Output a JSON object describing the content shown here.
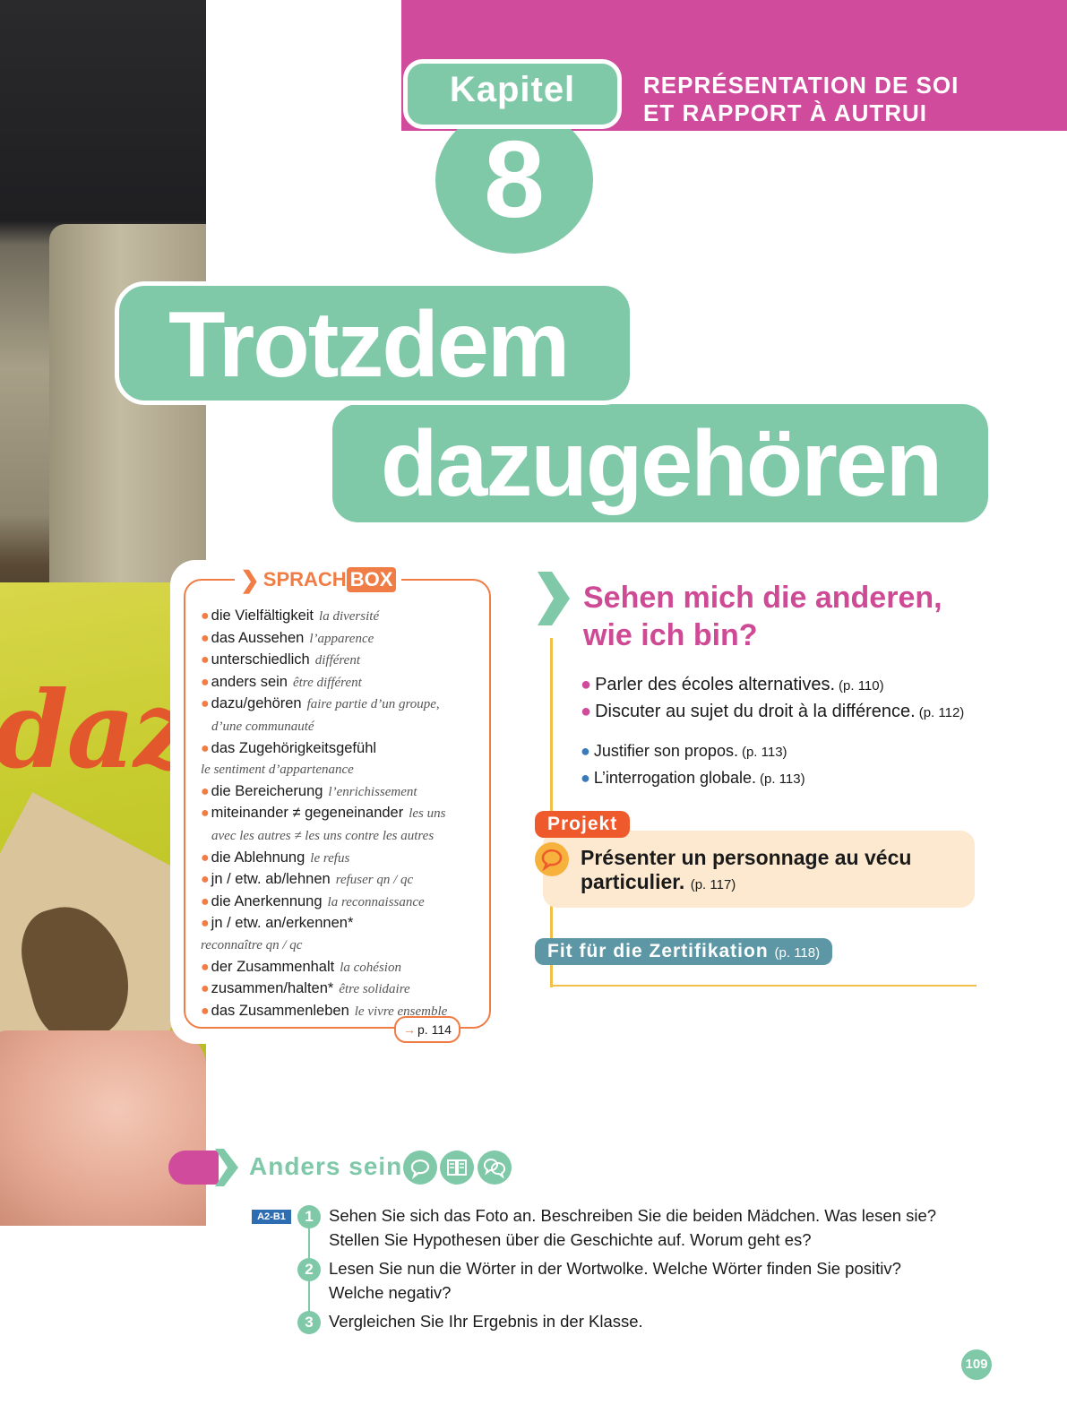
{
  "header": {
    "chapter_label": "Kapitel",
    "chapter_number": "8",
    "theme_line1": "REPRÉSENTATION DE SOI",
    "theme_line2": "ET RAPPORT À AUTRUI"
  },
  "title": {
    "line1": "Trotzdem",
    "line2": "dazugehören"
  },
  "photo": {
    "book_word": "dazu"
  },
  "sprachbox": {
    "label_part1": "SPRACH",
    "label_part2": "BOX",
    "items": [
      {
        "de": "die Vielfältigkeit",
        "fr": "la diversité"
      },
      {
        "de": "das Aussehen",
        "fr": "l’apparence"
      },
      {
        "de": "unterschiedlich",
        "fr": "différent"
      },
      {
        "de": "anders sein",
        "fr": "être différent"
      },
      {
        "de": "dazu/gehören",
        "fr": "faire partie d’un groupe,",
        "fr2": "d’une communauté"
      },
      {
        "de": "das Zugehörigkeitsgefühl",
        "fr2": "le sentiment d’appartenance"
      },
      {
        "de": "die Bereicherung",
        "fr": "l’enrichissement"
      },
      {
        "de": "miteinander ≠ gegeneinander",
        "fr": "les uns",
        "fr2": "avec les autres ≠ les uns contre les autres"
      },
      {
        "de": "die Ablehnung",
        "fr": "le refus"
      },
      {
        "de": "jn / etw. ab/lehnen",
        "fr": "refuser qn / qc"
      },
      {
        "de": "die Anerkennung",
        "fr": "la reconnaissance"
      },
      {
        "de": "jn / etw. an/erkennen*",
        "fr2": "reconnaître qn / qc"
      },
      {
        "de": "der Zusammenhalt",
        "fr": "la cohésion"
      },
      {
        "de": "zusammen/halten*",
        "fr": "être solidaire"
      },
      {
        "de": "das Zusammenleben",
        "fr": "le vivre ensemble"
      }
    ],
    "ref": "p. 114"
  },
  "question": {
    "title_line1": "Sehen mich die anderen,",
    "title_line2": "wie ich bin?",
    "goals": [
      {
        "text": "Parler des écoles alternatives.",
        "page": "(p. 110)"
      },
      {
        "text": "Discuter au sujet du droit à la différence.",
        "page": "(p. 112)"
      }
    ],
    "grammar": [
      {
        "text": "Justifier son propos.",
        "page": "(p. 113)"
      },
      {
        "text": "L’interrogation globale.",
        "page": "(p. 113)"
      }
    ]
  },
  "projekt": {
    "tag": "Projekt",
    "line1": "Présenter un personnage au vécu",
    "line2": "particulier.",
    "page": "(p. 117)"
  },
  "fit": {
    "label": "Fit für die Zertifikation",
    "page": "(p. 118)"
  },
  "section": {
    "title": "Anders sein",
    "level": "A2-B1",
    "icons": [
      "speech-bubble-icon",
      "book-icon",
      "dialogue-icon"
    ],
    "exercises": [
      {
        "num": "1",
        "line1": "Sehen Sie sich das Foto an. Beschreiben Sie die beiden Mädchen. Was lesen sie?",
        "line2": "Stellen Sie Hypothesen über die Geschichte auf. Worum geht es?"
      },
      {
        "num": "2",
        "line1": "Lesen Sie nun die Wörter in der Wortwolke. Welche Wörter finden Sie positiv?",
        "line2": "Welche negativ?"
      },
      {
        "num": "3",
        "line1": "Vergleichen Sie Ihr Ergebnis in der Klasse.",
        "line2": ""
      }
    ]
  },
  "page_number": "109",
  "colors": {
    "magenta": "#d14b9c",
    "mint": "#7fc8a8",
    "orange": "#ef7d45",
    "projekt_red": "#ef5a2c",
    "teal": "#5d97a6",
    "gold": "#f1c04a",
    "level_blue": "#2f6db3"
  }
}
